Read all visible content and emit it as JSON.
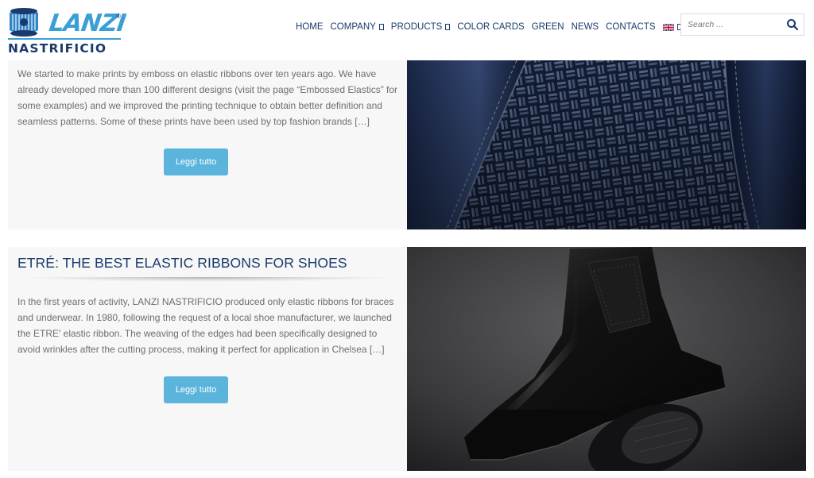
{
  "brand": {
    "logo_word": "LANZI",
    "logo_mark": "®",
    "logo_sub": "NASTRIFICIO"
  },
  "nav": {
    "items": [
      {
        "label": "HOME",
        "has_dropdown": false
      },
      {
        "label": "COMPANY",
        "has_dropdown": true
      },
      {
        "label": "PRODUCTS",
        "has_dropdown": true
      },
      {
        "label": "COLOR CARDS",
        "has_dropdown": false
      },
      {
        "label": "GREEN",
        "has_dropdown": false
      },
      {
        "label": "NEWS",
        "has_dropdown": false
      },
      {
        "label": "CONTACTS",
        "has_dropdown": false
      }
    ],
    "language_icon": "uk-flag-icon"
  },
  "search": {
    "placeholder": "Search ...",
    "icon": "search-icon"
  },
  "articles": [
    {
      "title": "",
      "excerpt": "We started to make prints by emboss on elastic ribbons over ten years ago. We have already developed more than 100 different designs (visit the page “Embossed Elastics” for some examples) and we improved the printing technique to obtain better definition and seamless patterns. Some of these prints have been used by top fashion brands […]",
      "button_label": "Leggi tutto",
      "image": "embossed-elastic-leather-image"
    },
    {
      "title": "ETRÉ: THE BEST ELASTIC RIBBONS FOR SHOES",
      "excerpt": "In the first years of activity, LANZI NASTRIFICIO produced only elastic ribbons for braces and underwear. In 1980, following the request of a local shoe manufacturer, we launched the ETRE' elastic ribbon. The weaving of the edges had been specifically designed to avoid wrinkles after the cutting process, making it perfect for application in Chelsea […]",
      "button_label": "Leggi tutto",
      "image": "chelsea-boot-image"
    }
  ],
  "colors": {
    "brand_blue": "#1a3a6b",
    "accent_blue": "#5ab4dc",
    "card_bg": "#f7f7f7",
    "body_text": "#6e6e6e"
  }
}
